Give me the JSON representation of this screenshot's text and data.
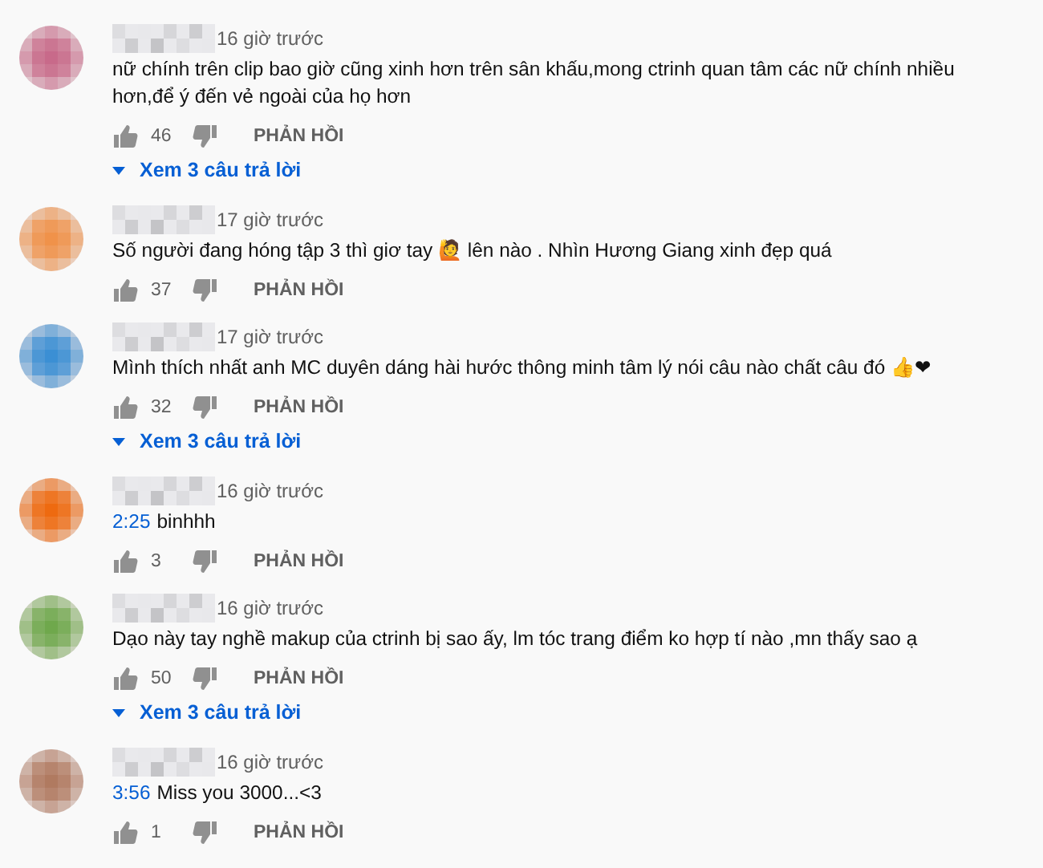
{
  "comments": [
    {
      "color": "#c86a8a",
      "time": "16 giờ trước",
      "text": "nữ chính trên clip bao giờ cũng xinh hơn trên sân khấu,mong ctrinh quan tâm các nữ chính nhiều hơn,để ý đến vẻ ngoài của họ hơn",
      "likes": "46",
      "reply_label": "PHẢN HỒI",
      "replies": "Xem 3 câu trả lời"
    },
    {
      "color": "#f0924a",
      "time": "17 giờ trước",
      "text": "Số người đang hóng tập 3 thì giơ tay 🙋 lên nào . Nhìn Hương Giang xinh đẹp quá",
      "likes": "37",
      "reply_label": "PHẢN HỒI"
    },
    {
      "color": "#3b8fd4",
      "time": "17 giờ trước",
      "text": "Mình thích nhất anh MC duyên dáng hài hước thông minh tâm lý nói câu nào chất câu đó 👍❤",
      "likes": "32",
      "reply_label": "PHẢN HỒI",
      "replies": "Xem 3 câu trả lời"
    },
    {
      "color": "#ee6a10",
      "time": "16 giờ trước",
      "timestamp": "2:25",
      "text": "binhhh",
      "likes": "3",
      "reply_label": "PHẢN HỒI"
    },
    {
      "color": "#6fa84c",
      "time": "16 giờ trước",
      "text": "Dạo này tay nghề makup của ctrinh bị sao ấy, lm tóc trang điểm ko hợp tí nào ,mn thấy sao ạ",
      "likes": "50",
      "reply_label": "PHẢN HỒI",
      "replies": "Xem 3 câu trả lời"
    },
    {
      "color": "#b07a60",
      "time": "16 giờ trước",
      "timestamp": "3:56",
      "text": "Miss you 3000...<3",
      "likes": "1",
      "reply_label": "PHẢN HỒI"
    }
  ]
}
